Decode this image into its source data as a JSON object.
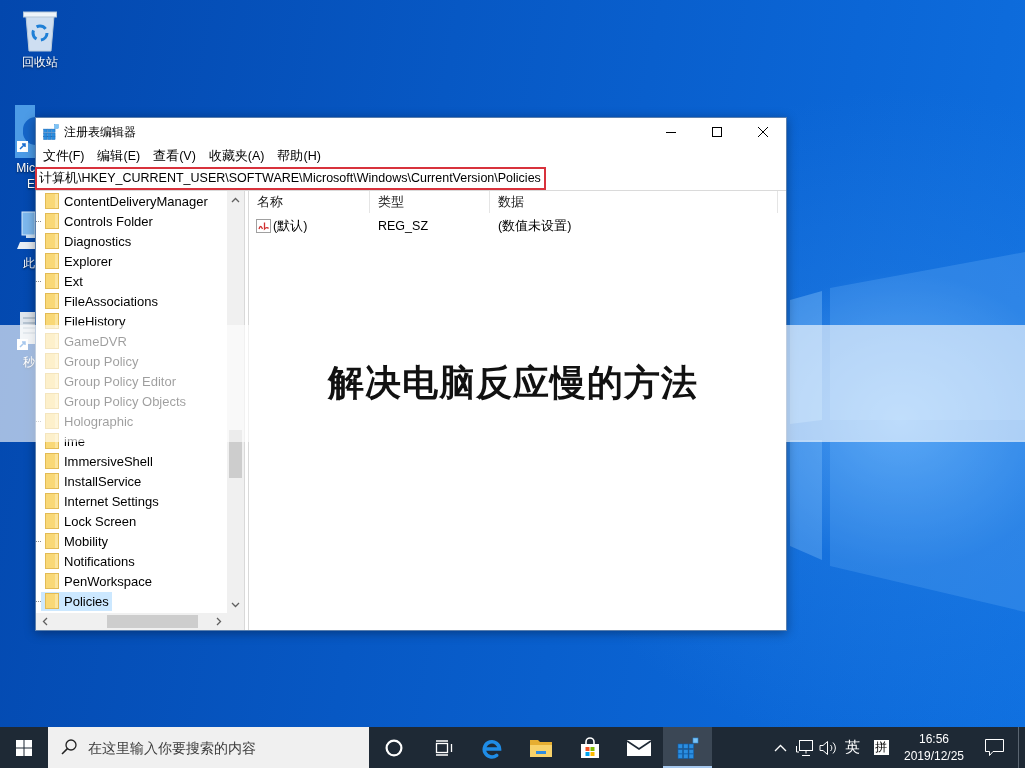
{
  "desktop": {
    "icons": [
      {
        "kind": "recycle-bin",
        "label": [
          "回收站"
        ]
      },
      {
        "kind": "browser-shortcut",
        "label": [
          "Mic",
          "E"
        ]
      },
      {
        "kind": "computer",
        "label": [
          "此"
        ]
      },
      {
        "kind": "app-shortcut",
        "label": [
          "秒"
        ]
      }
    ]
  },
  "window": {
    "title": "注册表编辑器",
    "menu": [
      "文件(F)",
      "编辑(E)",
      "查看(V)",
      "收藏夹(A)",
      "帮助(H)"
    ],
    "address": {
      "path": "计算机\\HKEY_CURRENT_USER\\SOFTWARE\\Microsoft\\Windows\\CurrentVersion\\Policies",
      "highlighted": true
    },
    "tree": [
      {
        "label": "ContentDeliveryManager",
        "expandable": false,
        "selected": false
      },
      {
        "label": "Controls Folder",
        "expandable": true,
        "selected": false
      },
      {
        "label": "Diagnostics",
        "expandable": false,
        "selected": false
      },
      {
        "label": "Explorer",
        "expandable": false,
        "selected": false
      },
      {
        "label": "Ext",
        "expandable": true,
        "selected": false
      },
      {
        "label": "FileAssociations",
        "expandable": false,
        "selected": false
      },
      {
        "label": "FileHistory",
        "expandable": false,
        "selected": false
      },
      {
        "label": "GameDVR",
        "expandable": false,
        "selected": false
      },
      {
        "label": "Group Policy",
        "expandable": false,
        "selected": false
      },
      {
        "label": "Group Policy Editor",
        "expandable": false,
        "selected": false
      },
      {
        "label": "Group Policy Objects",
        "expandable": false,
        "selected": false
      },
      {
        "label": "Holographic",
        "expandable": true,
        "selected": false
      },
      {
        "label": "ime",
        "expandable": false,
        "selected": false
      },
      {
        "label": "ImmersiveShell",
        "expandable": false,
        "selected": false
      },
      {
        "label": "InstallService",
        "expandable": false,
        "selected": false
      },
      {
        "label": "Internet Settings",
        "expandable": false,
        "selected": false
      },
      {
        "label": "Lock Screen",
        "expandable": false,
        "selected": false
      },
      {
        "label": "Mobility",
        "expandable": true,
        "selected": false
      },
      {
        "label": "Notifications",
        "expandable": false,
        "selected": false
      },
      {
        "label": "PenWorkspace",
        "expandable": false,
        "selected": false
      },
      {
        "label": "Policies",
        "expandable": true,
        "selected": true
      }
    ],
    "values": {
      "columns": [
        "名称",
        "类型",
        "数据"
      ],
      "rows": [
        {
          "kind": "string",
          "name": "(默认)",
          "type": "REG_SZ",
          "data": "(数值未设置)"
        }
      ]
    }
  },
  "caption_banner": {
    "text": "解决电脑反应慢的方法"
  },
  "taskbar": {
    "search": {
      "placeholder": "在这里输入你要搜索的内容"
    },
    "apps": [
      {
        "kind": "ring",
        "selected": false
      },
      {
        "kind": "task-view",
        "selected": false
      },
      {
        "kind": "browser",
        "selected": false
      },
      {
        "kind": "files",
        "selected": false
      },
      {
        "kind": "store",
        "selected": false
      },
      {
        "kind": "mail",
        "selected": false
      },
      {
        "kind": "registry-editor",
        "selected": true
      }
    ],
    "tray": {
      "language": "英",
      "ime": "拼",
      "time": "16:56",
      "date": "2019/12/25"
    }
  }
}
